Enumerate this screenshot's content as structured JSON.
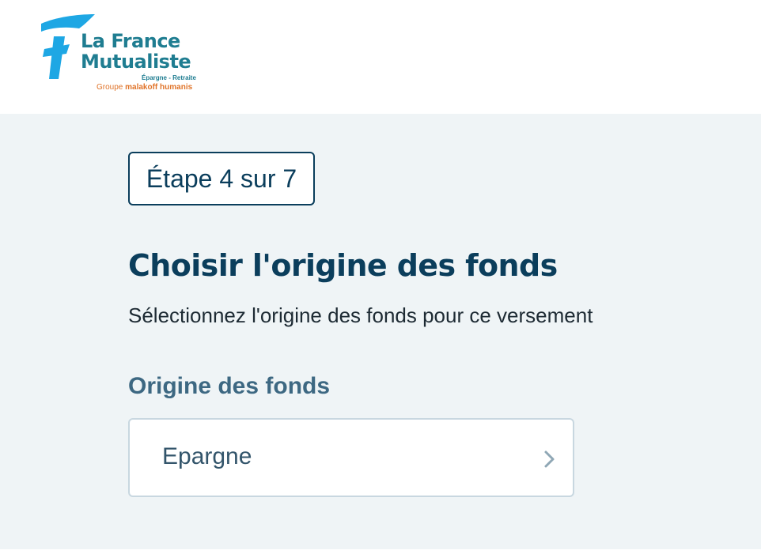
{
  "header": {
    "logo": {
      "line1": "La France",
      "line2": "Mutualiste",
      "tagline": "Épargne - Retraite",
      "group_prefix": "Groupe",
      "group_name": "malakoff humanis",
      "mark_icon": "lfm-f-mark-icon",
      "colors": {
        "mark": "#1ea7e4",
        "text": "#1f7d91",
        "group": "#e0742a"
      }
    }
  },
  "main": {
    "step_badge": "Étape 4 sur 7",
    "title": "Choisir l'origine des fonds",
    "subtitle": "Sélectionnez l'origine des fonds pour ce versement",
    "field": {
      "label": "Origine des fonds",
      "selected_value": "Epargne",
      "chevron_icon": "chevron-right-icon"
    }
  },
  "colors": {
    "page_background": "#eff4f6",
    "primary_text": "#0b3e5c",
    "label_text": "#3d6882",
    "field_border": "#c8d7e0",
    "chevron": "#8fa7b5"
  }
}
